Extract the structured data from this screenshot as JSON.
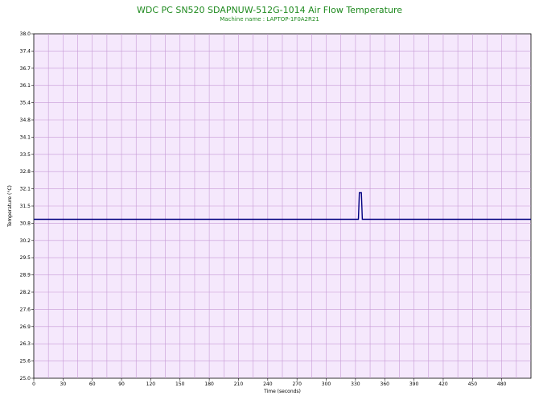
{
  "chart_data": {
    "type": "line",
    "title": "WDC PC SN520 SDAPNUW-512G-1014 Air Flow Temperature",
    "subtitle": "Machine name : LAPTOP-1F0A2R21",
    "xlabel": "Time (seconds)",
    "ylabel": "Temperature (°C)",
    "xlim": [
      0,
      510
    ],
    "ylim": [
      25.0,
      38.0
    ],
    "x_ticks": [
      "0",
      "30",
      "60",
      "90",
      "120",
      "150",
      "180",
      "210",
      "240",
      "270",
      "300",
      "330",
      "360",
      "390",
      "420",
      "450",
      "480"
    ],
    "y_ticks": [
      "25.0",
      "25.6",
      "26.3",
      "26.9",
      "27.6",
      "28.2",
      "28.9",
      "29.5",
      "30.2",
      "30.8",
      "31.5",
      "32.1",
      "32.8",
      "33.5",
      "34.1",
      "34.8",
      "35.4",
      "36.1",
      "36.7",
      "37.4",
      "38.0"
    ],
    "grid": true,
    "colors": {
      "plot_background": "#f5e8fc",
      "grid": "#c79ad6",
      "line": "#000080",
      "title": "#1f8a1f"
    },
    "series": [
      {
        "values": [
          [
            0,
            31.0
          ],
          [
            333,
            31.0
          ],
          [
            334,
            32.0
          ],
          [
            336,
            32.0
          ],
          [
            337,
            31.0
          ],
          [
            510,
            31.0
          ]
        ]
      }
    ]
  }
}
